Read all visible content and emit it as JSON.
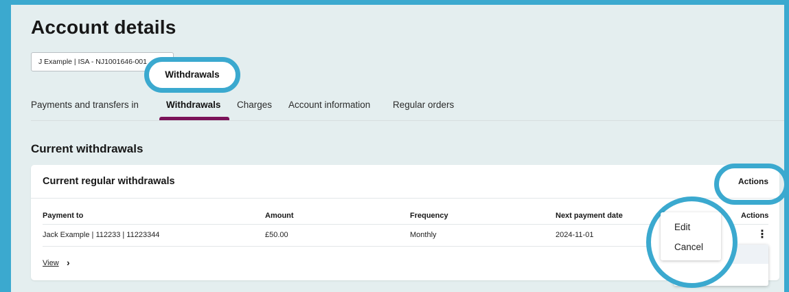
{
  "page": {
    "title": "Account details",
    "account_selector": "J Example | ISA - NJ1001646-001"
  },
  "tabs": [
    {
      "label": "Payments and transfers in",
      "active": false
    },
    {
      "label": "Withdrawals",
      "active": true
    },
    {
      "label": "Charges",
      "active": false
    },
    {
      "label": "Account information",
      "active": false
    },
    {
      "label": "Regular orders",
      "active": false
    }
  ],
  "section": {
    "title": "Current withdrawals"
  },
  "card": {
    "title": "Current regular withdrawals",
    "actions_label": "Actions",
    "columns": [
      "Payment to",
      "Amount",
      "Frequency",
      "Next payment date",
      "Actions"
    ],
    "rows": [
      {
        "payment_to": "Jack Example | 112233 | 11223344",
        "amount": "£50.00",
        "frequency": "Monthly",
        "next_payment_date": "2024-11-01"
      }
    ],
    "view_link": "View"
  },
  "row_menu": {
    "items": [
      "Edit",
      "Cancel"
    ]
  },
  "callouts": {
    "tab_zoom_label": "Withdrawals"
  },
  "colors": {
    "highlight": "#3ba9cf",
    "tab_underline": "#7a1359",
    "page_background": "#e4eeef"
  }
}
